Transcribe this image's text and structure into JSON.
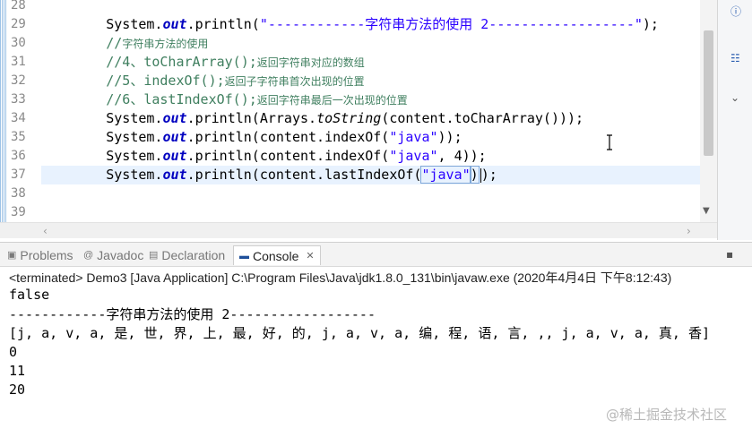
{
  "editor": {
    "line_numbers": [
      "28",
      "29",
      "30",
      "31",
      "32",
      "33",
      "34",
      "35",
      "36",
      "37",
      "38",
      "39"
    ],
    "lines": {
      "l29": {
        "pre": "System.",
        "field": "out",
        "mid": ".println(",
        "str": "\"------------字符串方法的使用 2------------------\"",
        "end": ");"
      },
      "l30": {
        "slashes": "//",
        "comment": "字符串方法的使用"
      },
      "l31": {
        "code": "//4、toCharArray();",
        "comment": "返回字符串对应的数组"
      },
      "l32": {
        "code": "//5、indexOf();",
        "comment": "返回子字符串首次出现的位置"
      },
      "l33": {
        "code": "//6、lastIndexOf();",
        "comment": "返回字符串最后一次出现的位置"
      },
      "l34": {
        "pre": "System.",
        "field": "out",
        "mid": ".println(Arrays.",
        "method": "toString",
        "end": "(content.toCharArray()));"
      },
      "l35": {
        "pre": "System.",
        "field": "out",
        "mid": ".println(content.indexOf(",
        "str": "\"java\"",
        "end": "));"
      },
      "l36": {
        "pre": "System.",
        "field": "out",
        "mid": ".println(content.indexOf(",
        "str": "\"java\"",
        "end": ", 4));"
      },
      "l37": {
        "pre": "System.",
        "field": "out",
        "mid": ".println(content.lastIndexOf(",
        "str": "\"java\"",
        "end": ")",
        "end2": ");"
      }
    }
  },
  "tabs": [
    {
      "label": "Problems",
      "icon": "problems-icon"
    },
    {
      "label": "Javadoc",
      "icon": "javadoc-icon"
    },
    {
      "label": "Declaration",
      "icon": "declaration-icon"
    },
    {
      "label": "Console",
      "icon": "console-icon",
      "close": "✕"
    }
  ],
  "console": {
    "status": "<terminated> Demo3 [Java Application] C:\\Program Files\\Java\\jdk1.8.0_131\\bin\\javaw.exe (2020年4月4日 下午8:12:43)",
    "output": [
      "false",
      "------------字符串方法的使用 2------------------",
      "[j, a, v, a, 是, 世, 界, 上, 最, 好, 的, j, a, v, a, 编, 程, 语, 言, ,, j, a, v, a, 真, 香]",
      "0",
      "11",
      "20"
    ]
  },
  "watermark": "@稀土掘金技术社区",
  "colors": {
    "keyword_field": "#0000c0",
    "string": "#2a00ff",
    "comment": "#3f7f5f",
    "current_line": "#e8f2fe"
  }
}
